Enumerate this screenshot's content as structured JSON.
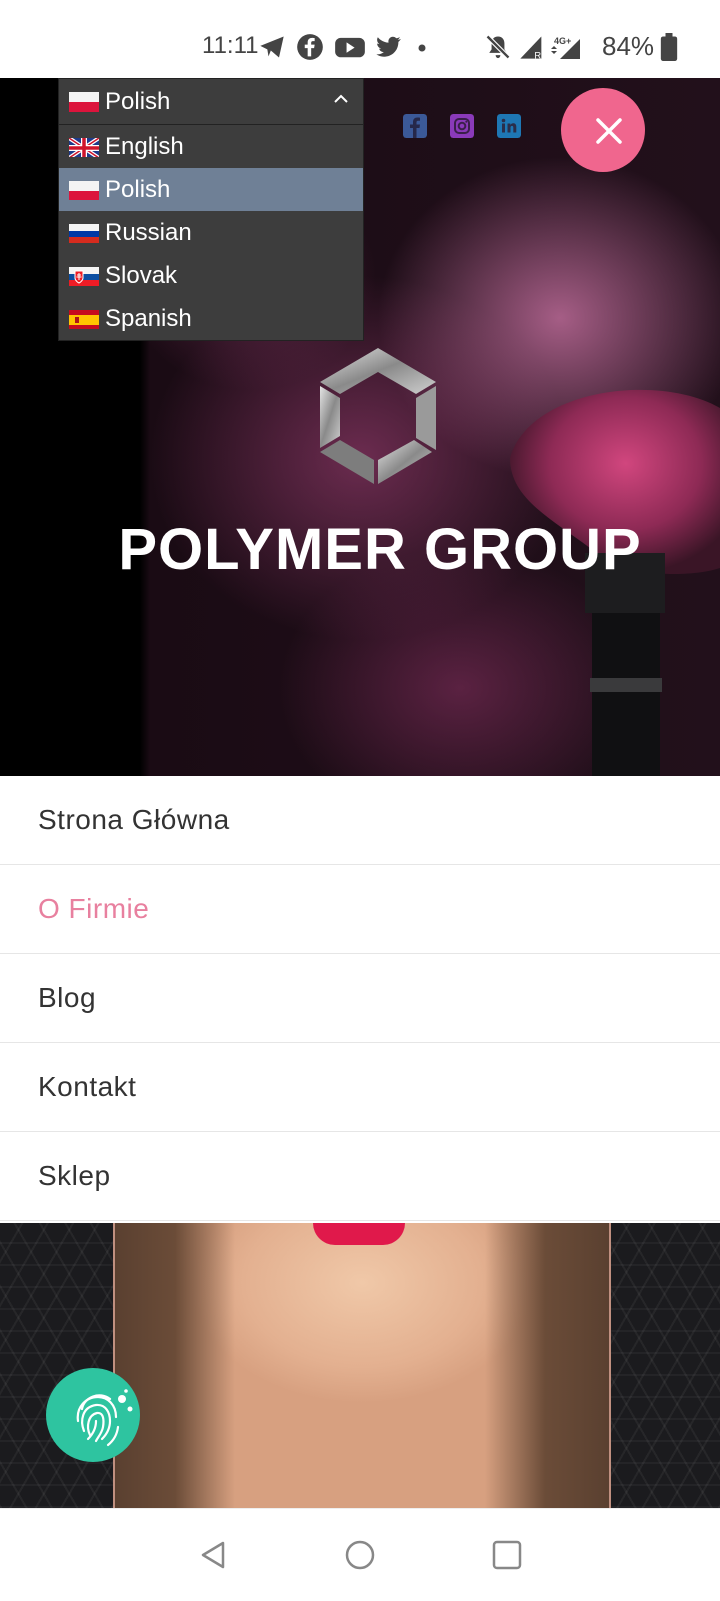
{
  "status_bar": {
    "time": "11:11",
    "battery": "84%",
    "icons": [
      "telegram-icon",
      "facebook-icon",
      "youtube-icon",
      "twitter-icon",
      "dot-icon",
      "mute-icon",
      "signal-icon",
      "network-4g-icon",
      "signal-full-icon",
      "battery-icon"
    ]
  },
  "language_dropdown": {
    "selected": "Polish",
    "options": [
      {
        "label": "English",
        "flag": "uk"
      },
      {
        "label": "Polish",
        "flag": "pl"
      },
      {
        "label": "Russian",
        "flag": "ru"
      },
      {
        "label": "Slovak",
        "flag": "sk"
      },
      {
        "label": "Spanish",
        "flag": "es"
      }
    ]
  },
  "hero": {
    "brand": "POLYMER GROUP",
    "social": [
      "facebook-icon",
      "instagram-icon",
      "linkedin-icon"
    ]
  },
  "nav": {
    "items": [
      {
        "label": "Strona Główna"
      },
      {
        "label": "O Firmie",
        "active": true
      },
      {
        "label": "Blog"
      },
      {
        "label": "Kontakt"
      },
      {
        "label": "Sklep"
      }
    ]
  },
  "colors": {
    "accent": "#f0668e",
    "active_link": "#e8809f",
    "fab": "#2ec4a0",
    "dropdown_bg": "#3d3d3d",
    "dropdown_selected": "#6f8096"
  }
}
